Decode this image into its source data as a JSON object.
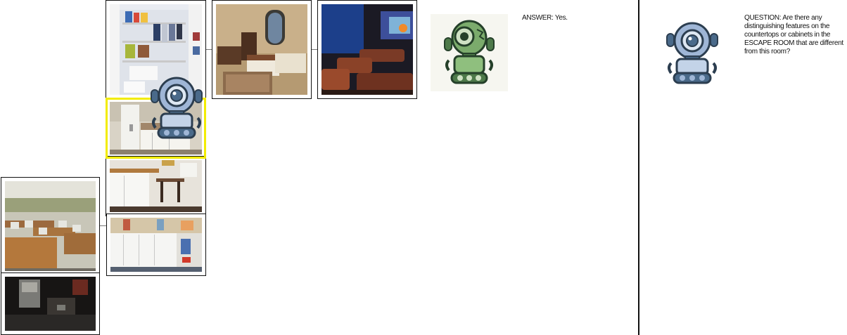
{
  "answer_panel": {
    "text": "ANSWER: Yes.",
    "agent_icon": "green-robot-icon"
  },
  "question_panel": {
    "text": "QUESTION: Are there any distinguishing features on the countertops or cabinets in the ESCAPE ROOM that are different from this room?",
    "agent_icon": "blue-robot-icon"
  },
  "map": {
    "current_room": "kitchen",
    "agent_icon": "blue-robot-icon",
    "highlight_color": "#f2ec00",
    "rooms": [
      "closet",
      "bedroom",
      "home-theater",
      "kitchen",
      "kitchen-dining",
      "office-kitchenette",
      "computer-lab",
      "dark-room"
    ]
  }
}
